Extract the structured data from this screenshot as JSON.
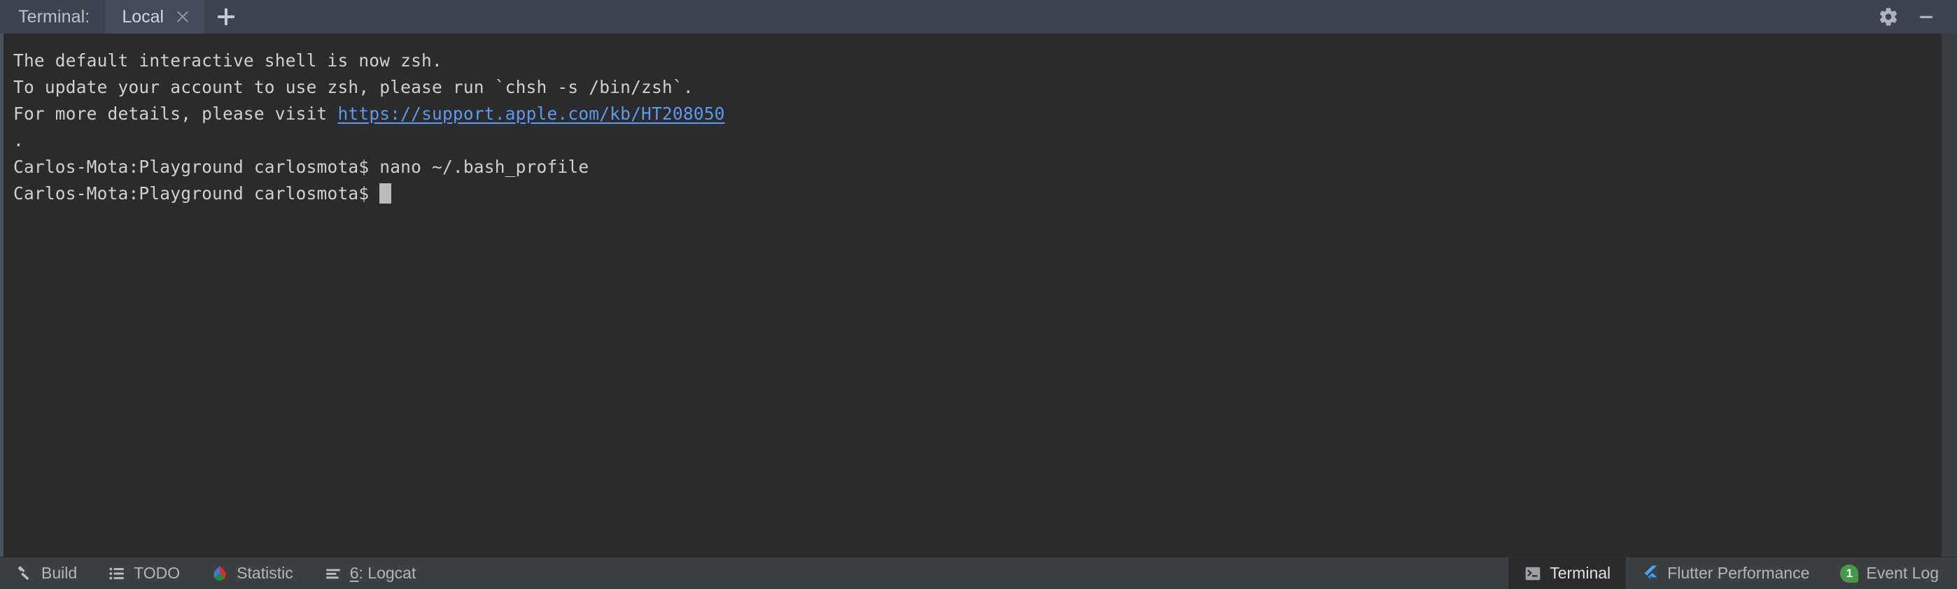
{
  "header": {
    "tool_window_label": "Terminal:",
    "tabs": [
      {
        "label": "Local",
        "close_icon": "close-icon",
        "active": true
      }
    ],
    "add_tab_icon": "plus-icon",
    "settings_icon": "gear-icon",
    "hide_icon": "minimize-icon"
  },
  "terminal": {
    "lines": [
      {
        "type": "text",
        "text": "The default interactive shell is now zsh."
      },
      {
        "type": "text",
        "text": "To update your account to use zsh, please run `chsh -s /bin/zsh`."
      },
      {
        "type": "link_line",
        "prefix": "For more details, please visit ",
        "link": "https://support.apple.com/kb/HT208050"
      },
      {
        "type": "text",
        "text": "."
      },
      {
        "type": "text",
        "text": "Carlos-Mota:Playground carlosmota$ nano ~/.bash_profile"
      },
      {
        "type": "prompt",
        "text": "Carlos-Mota:Playground carlosmota$ "
      }
    ],
    "link_color": "#5a9bf0",
    "text_color": "#cfd0d0",
    "background": "#2b2b2b"
  },
  "status_bar": {
    "left_items": [
      {
        "label": "Build",
        "icon": "hammer-icon",
        "mnemonic": ""
      },
      {
        "label": "TODO",
        "icon": "checklist-icon",
        "mnemonic": ""
      },
      {
        "label": "Statistic",
        "icon": "statistic-droplet-icon",
        "mnemonic": ""
      },
      {
        "label": ": Logcat",
        "icon": "logcat-lines-icon",
        "mnemonic": "6"
      }
    ],
    "right_items": [
      {
        "label": "Terminal",
        "icon": "terminal-prompt-icon",
        "active": true
      },
      {
        "label": "Flutter Performance",
        "icon": "flutter-icon",
        "active": false
      },
      {
        "label": "Event Log",
        "icon": "event-count-badge",
        "badge": "1",
        "active": false
      }
    ]
  },
  "colors": {
    "header_bg": "#3c4450",
    "tab_active_bg": "#414b59",
    "terminal_bg": "#2b2b2b",
    "status_bg": "#3c3f41",
    "accent_link": "#5a9bf0",
    "badge_green": "#449a49",
    "flutter_blue": "#42a5f5"
  }
}
